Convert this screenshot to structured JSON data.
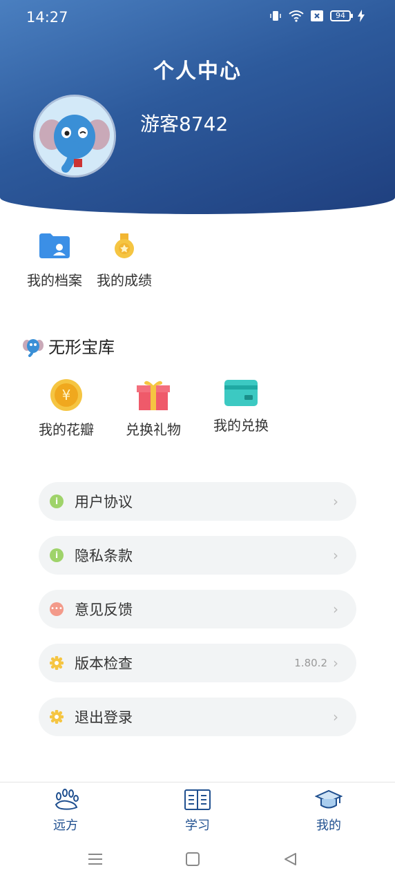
{
  "status": {
    "time": "14:27",
    "battery": "94"
  },
  "header": {
    "title": "个人中心",
    "username": "游客8742"
  },
  "quick_links": [
    {
      "label": "我的档案",
      "icon": "profile-folder-icon"
    },
    {
      "label": "我的成绩",
      "icon": "medal-icon"
    }
  ],
  "treasure": {
    "title": "无形宝库",
    "items": [
      {
        "label": "我的花瓣",
        "icon": "coin-icon"
      },
      {
        "label": "兑换礼物",
        "icon": "gift-icon"
      },
      {
        "label": "我的兑换",
        "icon": "card-icon"
      }
    ]
  },
  "menu": [
    {
      "label": "用户协议",
      "icon": "info-icon",
      "color": "#9fd36a",
      "value": ""
    },
    {
      "label": "隐私条款",
      "icon": "info-icon",
      "color": "#9fd36a",
      "value": ""
    },
    {
      "label": "意见反馈",
      "icon": "chat-icon",
      "color": "#f39a8a",
      "value": ""
    },
    {
      "label": "版本检查",
      "icon": "gear-icon",
      "color": "#f5c542",
      "value": "1.80.2"
    },
    {
      "label": "退出登录",
      "icon": "gear-icon",
      "color": "#f5c542",
      "value": ""
    }
  ],
  "tabs": [
    {
      "label": "远方",
      "icon": "paw-icon"
    },
    {
      "label": "学习",
      "icon": "book-icon"
    },
    {
      "label": "我的",
      "icon": "graduation-cap-icon"
    }
  ],
  "colors": {
    "header_start": "#4a7fc0",
    "header_end": "#1f3f7e",
    "tab_active": "#1f4f8f"
  }
}
